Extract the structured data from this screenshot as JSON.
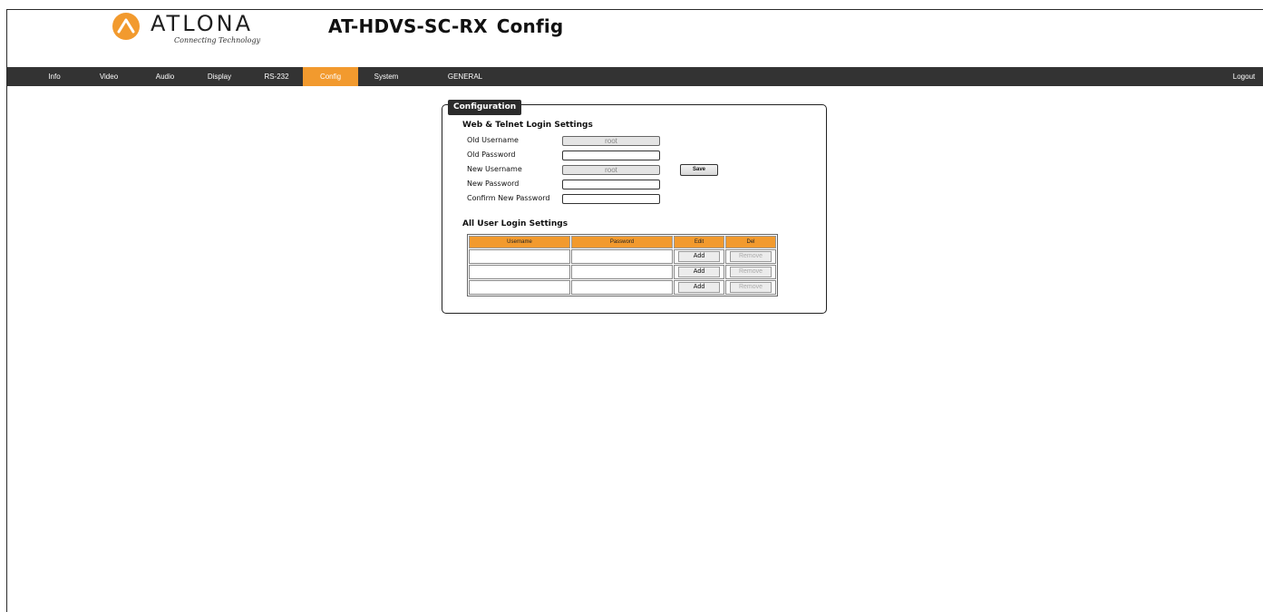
{
  "brand": {
    "name": "ATLONA",
    "tagline": "Connecting Technology",
    "accent": "#f29a2e"
  },
  "page": {
    "model": "AT-HDVS-SC-RX",
    "section": "Config"
  },
  "nav": {
    "items": [
      {
        "label": "Info",
        "active": false
      },
      {
        "label": "Video",
        "active": false
      },
      {
        "label": "Audio",
        "active": false
      },
      {
        "label": "Display",
        "active": false
      },
      {
        "label": "RS-232",
        "active": false
      },
      {
        "label": "Config",
        "active": true
      },
      {
        "label": "System",
        "active": false
      },
      {
        "label": "GENERAL",
        "active": false
      }
    ],
    "logout": "Logout",
    "background": "#333333"
  },
  "config": {
    "legend": "Configuration",
    "web_telnet": {
      "title": "Web & Telnet Login Settings",
      "old_username_label": "Old Username",
      "old_username_value": "root",
      "old_password_label": "Old Password",
      "old_password_value": "",
      "new_username_label": "New Username",
      "new_username_value": "root",
      "new_password_label": "New Password",
      "new_password_value": "",
      "confirm_password_label": "Confirm New Password",
      "confirm_password_value": "",
      "save_label": "Save"
    },
    "users": {
      "title": "All User Login Settings",
      "columns": [
        "Username",
        "Password",
        "Edit",
        "Del"
      ],
      "rows": [
        {
          "username": "",
          "password": "",
          "edit": "Add",
          "del": "Remove"
        },
        {
          "username": "",
          "password": "",
          "edit": "Add",
          "del": "Remove"
        },
        {
          "username": "",
          "password": "",
          "edit": "Add",
          "del": "Remove"
        }
      ]
    }
  }
}
